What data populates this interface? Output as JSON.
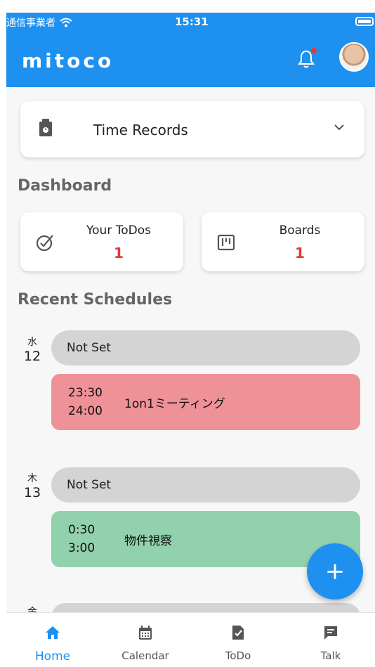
{
  "status_bar": {
    "carrier": "通信事業者",
    "time": "15:31"
  },
  "header": {
    "logo": "mitoco"
  },
  "time_records": {
    "title": "Time Records"
  },
  "dashboard": {
    "title": "Dashboard",
    "todos": {
      "label": "Your ToDos",
      "count": "1"
    },
    "boards": {
      "label": "Boards",
      "count": "1"
    }
  },
  "recent": {
    "title": "Recent Schedules",
    "days": [
      {
        "weekday": "水",
        "day": "12",
        "not_set": "Not Set",
        "event": {
          "start": "23:30",
          "end": "24:00",
          "title": "1on1ミーティング",
          "color": "#ef9297"
        }
      },
      {
        "weekday": "木",
        "day": "13",
        "not_set": "Not Set",
        "event": {
          "start": "0:30",
          "end": "3:00",
          "title": "物件視察",
          "color": "#92d1ad"
        }
      },
      {
        "weekday": "金"
      }
    ]
  },
  "fab": {
    "label": "+"
  },
  "nav": {
    "home": "Home",
    "calendar": "Calendar",
    "todo": "ToDo",
    "talk": "Talk"
  },
  "colors": {
    "primary": "#1e90f0",
    "alert": "#e53935"
  }
}
